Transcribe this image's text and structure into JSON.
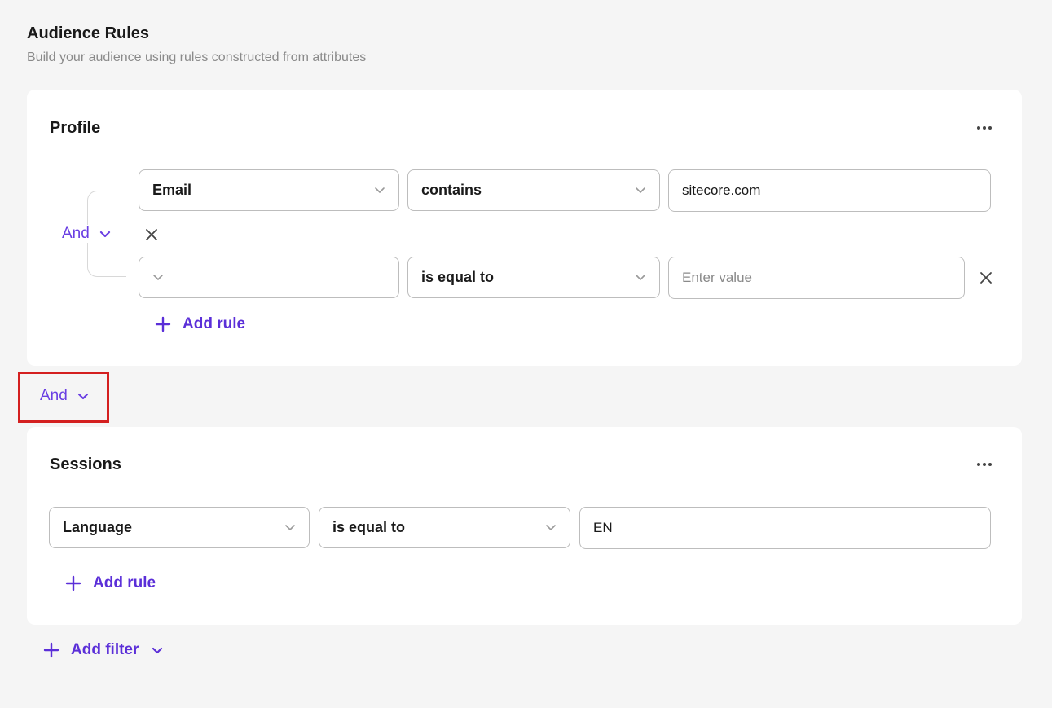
{
  "header": {
    "title": "Audience Rules",
    "subtitle": "Build your audience using rules constructed from attributes"
  },
  "profile": {
    "title": "Profile",
    "group_operator": "And",
    "rules": [
      {
        "attribute": "Email",
        "operator": "contains",
        "value": "sitecore.com",
        "placeholder": ""
      },
      {
        "attribute": "",
        "operator": "is equal to",
        "value": "",
        "placeholder": "Enter value"
      }
    ],
    "add_rule_label": "Add rule"
  },
  "between_operator": "And",
  "sessions": {
    "title": "Sessions",
    "rules": [
      {
        "attribute": "Language",
        "operator": "is equal to",
        "value": "EN"
      }
    ],
    "add_rule_label": "Add rule"
  },
  "footer": {
    "add_filter_label": "Add filter"
  },
  "colors": {
    "accent": "#5b2fd8",
    "highlight": "#d42020",
    "background": "#f5f5f5"
  }
}
